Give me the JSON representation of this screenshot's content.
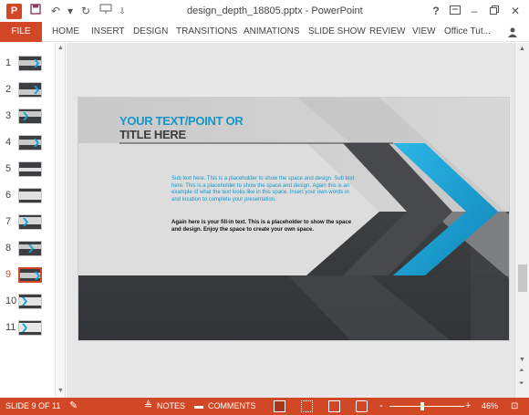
{
  "window": {
    "title": "design_depth_18805.pptx - PowerPoint",
    "app_icon": "P",
    "quick_access": [
      "save-icon",
      "undo-icon",
      "redo-icon",
      "slideshow-icon"
    ],
    "help": "?",
    "controls": [
      "ribbon-display-icon",
      "minimize-icon",
      "restore-icon",
      "close-icon"
    ]
  },
  "ribbon": {
    "file": "FILE",
    "tabs": [
      "HOME",
      "INSERT",
      "DESIGN",
      "TRANSITIONS",
      "ANIMATIONS",
      "SLIDE SHOW",
      "REVIEW",
      "VIEW",
      "Office Tut..."
    ]
  },
  "thumbnails": {
    "numbers": [
      "1",
      "2",
      "3",
      "4",
      "5",
      "6",
      "7",
      "8",
      "9",
      "10",
      "11"
    ],
    "selected": "9"
  },
  "slide": {
    "title_line1": "YOUR TEXT/POINT OR",
    "title_line2": "TITLE HERE",
    "blue_text": "Sub text here. This is a placeholder to show the space and design. Sub text here. This is a placeholder to show the space and design. Again this is an example of what the text looks like in this space. Insert your own words in and location to complete your presentation.",
    "black_text": "Again here is your fill-in text. This is a placeholder to show the space and design. Enjoy the space to create your own space.",
    "colors": {
      "accent": "#1597c9",
      "dark": "#3a3c3f",
      "light": "#c9c9c9"
    }
  },
  "status": {
    "slide_info": "SLIDE 9 OF 11",
    "notes": "NOTES",
    "comments": "COMMENTS",
    "zoom_minus": "-",
    "zoom_plus": "+",
    "zoom": "46%",
    "zoom_level": 0.46
  }
}
